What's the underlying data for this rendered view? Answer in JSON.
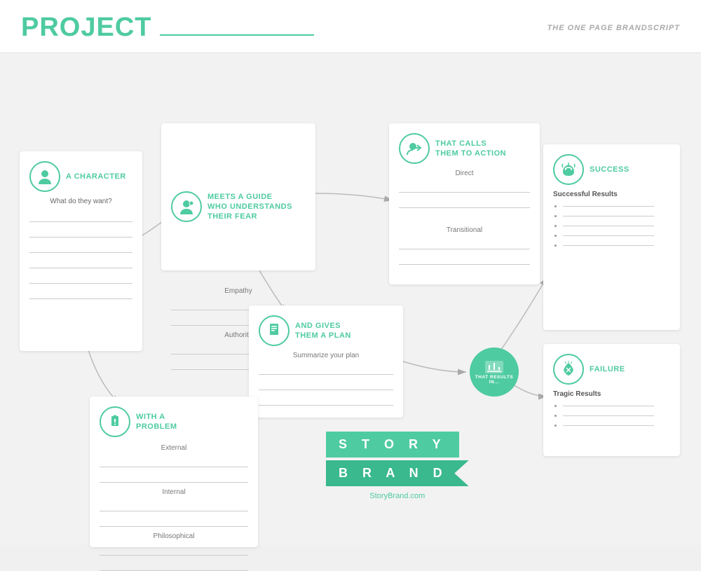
{
  "header": {
    "title": "PROJECT",
    "subtitle": "THE ONE PAGE BRANDSCRIPT"
  },
  "character_card": {
    "icon": "person-icon",
    "title": "A CHARACTER",
    "subtitle": "What do they want?",
    "lines": 6
  },
  "guide_card": {
    "icon": "guide-icon",
    "title": "MEETS A GUIDE\nWHO UNDERSTANDS\nTHEIR FEAR",
    "fields": [
      "Empathy",
      "Authority"
    ]
  },
  "cta_card": {
    "icon": "cta-icon",
    "title": "THAT CALLS\nTHEM TO ACTION",
    "fields": [
      "Direct",
      "Transitional"
    ]
  },
  "plan_card": {
    "icon": "plan-icon",
    "title": "AND GIVES\nTHEM A PLAN",
    "field_label": "Summarize your plan",
    "lines": 3
  },
  "problem_card": {
    "icon": "problem-icon",
    "title": "WITH A\nPROBLEM",
    "fields": [
      "External",
      "Internal",
      "Philosophical"
    ]
  },
  "results_badge": {
    "label": "THAT RESULTS IN..."
  },
  "success_card": {
    "icon": "success-icon",
    "title": "SUCCESS",
    "subtitle": "Successful Results",
    "bullets": 5
  },
  "failure_card": {
    "icon": "failure-icon",
    "title": "FAILURE",
    "subtitle": "Tragic Results",
    "bullets": 3
  },
  "storybrand": {
    "story": "S T O R Y",
    "brand": "B R A N D",
    "url": "StoryBrand.com"
  },
  "colors": {
    "accent": "#4ecba0",
    "text_dark": "#555",
    "text_light": "#999"
  }
}
